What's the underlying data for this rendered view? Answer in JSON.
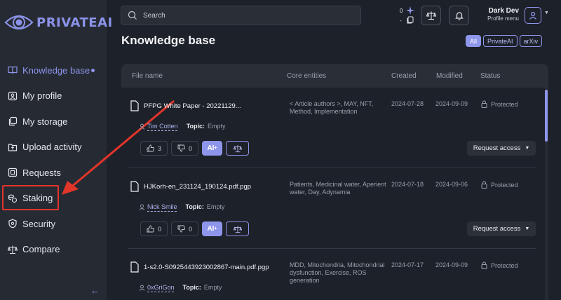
{
  "brand": {
    "name": "PRIVATEAI"
  },
  "sidebar": {
    "items": [
      {
        "label": "Knowledge base",
        "icon": "book-icon",
        "active": true
      },
      {
        "label": "My profile",
        "icon": "profile-card-icon"
      },
      {
        "label": "My storage",
        "icon": "copy-icon"
      },
      {
        "label": "Upload activity",
        "icon": "folder-upload-icon"
      },
      {
        "label": "Requests",
        "icon": "requests-icon"
      },
      {
        "label": "Staking",
        "icon": "coins-icon"
      },
      {
        "label": "Security",
        "icon": "shield-icon"
      },
      {
        "label": "Compare",
        "icon": "scales-icon"
      }
    ],
    "collapse_icon": "arrow-left-icon"
  },
  "topbar": {
    "search_placeholder": "Search",
    "counter_top": "0",
    "counter_bottom": "-",
    "user_name": "Dark Dev",
    "user_sub": "Profile menu"
  },
  "page": {
    "title": "Knowledge base"
  },
  "filters": [
    "All",
    "PrivateAI",
    "arXiv"
  ],
  "table": {
    "headers": [
      "File name",
      "Core entities",
      "Created",
      "Modified",
      "Status"
    ],
    "rows": [
      {
        "file": "PFPG White Paper - 20221129...",
        "author": "Tim Cotten",
        "topic_label": "Topic:",
        "topic": "Empty",
        "entities": "< Article authors >, MAY, NFT, Method, Implementation",
        "created": "2024-07-28",
        "modified": "2024-09-09",
        "status": "Protected",
        "likes": "3",
        "dislikes": "0",
        "request_label": "Request access"
      },
      {
        "file": "HJKorh-en_231124_190124.pdf.pgp",
        "author": "Nick Smile",
        "topic_label": "Topic:",
        "topic": "Empty",
        "entities": "Patients, Medicinal water, Aperient water, Day, Adynamia",
        "created": "2024-07-18",
        "modified": "2024-09-06",
        "status": "Protected",
        "likes": "0",
        "dislikes": "0",
        "request_label": "Request access"
      },
      {
        "file": "1-s2.0-S0925443923002867-main.pdf.pgp",
        "author": "0xGriGon",
        "topic_label": "Topic:",
        "topic": "Empty",
        "entities": "MDD, Mitochondria, Mitochondrial dysfunction, Exercise, ROS generation",
        "created": "2024-07-17",
        "modified": "2024-09-09",
        "status": "Protected"
      }
    ],
    "ai_label": "AI"
  },
  "colors": {
    "accent": "#8e96ec",
    "background": "#1d2129",
    "sidebar": "#262a33",
    "annotation": "#e2352a"
  }
}
